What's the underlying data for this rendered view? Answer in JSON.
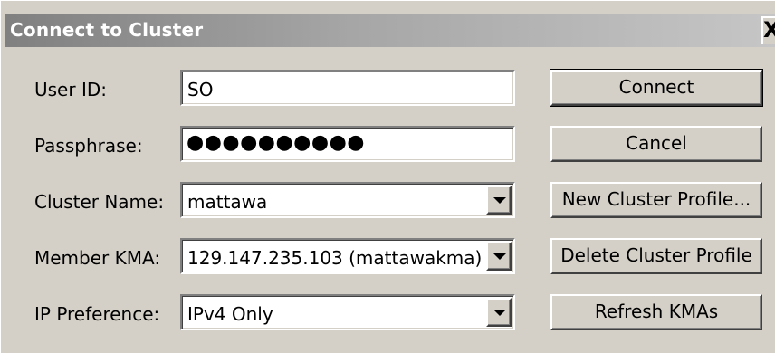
{
  "window": {
    "title": "Connect to Cluster",
    "close_glyph": "X"
  },
  "form": {
    "user_id": {
      "label": "User ID:",
      "value": "SO"
    },
    "passphrase": {
      "label": "Passphrase:",
      "value": "●●●●●●●●●●"
    },
    "cluster_name": {
      "label": "Cluster Name:",
      "value": "mattawa"
    },
    "member_kma": {
      "label": "Member KMA:",
      "value": "129.147.235.103 (mattawakma)"
    },
    "ip_preference": {
      "label": "IP Preference:",
      "value": "IPv4 Only"
    }
  },
  "buttons": {
    "connect": "Connect",
    "cancel": "Cancel",
    "new_profile": "New Cluster Profile...",
    "delete_profile": "Delete Cluster Profile",
    "refresh_kmas": "Refresh KMAs"
  },
  "icons": {
    "dropdown": "chevron-down-icon",
    "close": "close-icon"
  },
  "colors": {
    "dialog_bg": "#d4d0c8",
    "title_start": "#808080",
    "title_end": "#c6c6c6",
    "title_text": "#ffffff"
  }
}
